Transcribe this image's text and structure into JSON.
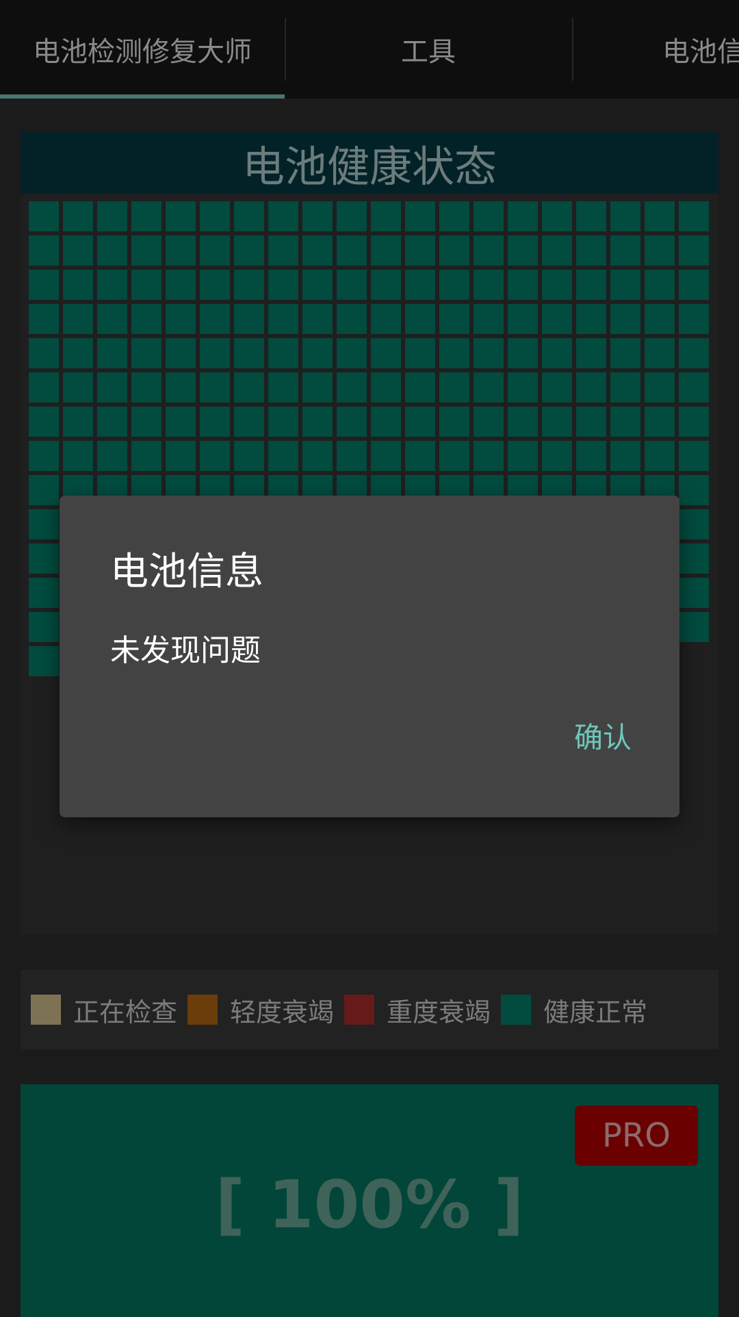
{
  "tabs": [
    {
      "label": "电池检测修复大师",
      "active": true
    },
    {
      "label": "工具",
      "active": false
    },
    {
      "label": "电池信",
      "active": false
    }
  ],
  "health": {
    "title": "电池健康状态",
    "grid": {
      "columns": 20,
      "rows_full": 13,
      "last_row_cells": 1,
      "cell_status": "健康正常"
    }
  },
  "legend": [
    {
      "label": "正在检查",
      "color": "#7d7354"
    },
    {
      "label": "轻度衰竭",
      "color": "#6a3d0a"
    },
    {
      "label": "重度衰竭",
      "color": "#661a19"
    },
    {
      "label": "健康正常",
      "color": "#024b3f"
    }
  ],
  "percent_panel": {
    "badge": "PRO",
    "value": "[ 100% ]"
  },
  "dialog": {
    "title": "电池信息",
    "message": "未发现问题",
    "confirm_label": "确认"
  },
  "colors": {
    "accent": "#6fc6bb",
    "healthy_cell": "#024b3f",
    "tab_indicator": "#4b7670"
  }
}
